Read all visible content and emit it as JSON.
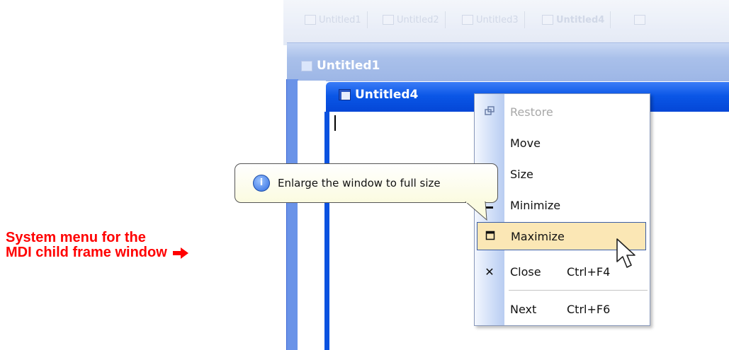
{
  "tabs": [
    {
      "label": "Untitled1",
      "bold": false
    },
    {
      "label": "Untitled2",
      "bold": false
    },
    {
      "label": "Untitled3",
      "bold": false
    },
    {
      "label": "Untitled4",
      "bold": true
    },
    {
      "label": "",
      "bold": false
    }
  ],
  "background_window": {
    "title": "Untitled1"
  },
  "active_window": {
    "title": "Untitled4"
  },
  "system_menu": {
    "items": [
      {
        "label": "Restore",
        "shortcut": "",
        "icon": "restore-icon",
        "disabled": true,
        "highlighted": false
      },
      {
        "label": "Move",
        "shortcut": "",
        "icon": "",
        "disabled": false,
        "highlighted": false
      },
      {
        "label": "Size",
        "shortcut": "",
        "icon": "",
        "disabled": false,
        "highlighted": false
      },
      {
        "label": "Minimize",
        "shortcut": "",
        "icon": "minimize-icon",
        "disabled": false,
        "highlighted": false
      },
      {
        "label": "Maximize",
        "shortcut": "",
        "icon": "maximize-icon",
        "disabled": false,
        "highlighted": true
      },
      {
        "label": "Close",
        "shortcut": "Ctrl+F4",
        "icon": "close-icon",
        "disabled": false,
        "highlighted": false
      },
      {
        "label": "Next",
        "shortcut": "Ctrl+F6",
        "icon": "",
        "disabled": false,
        "highlighted": false
      }
    ]
  },
  "tooltip": {
    "text": "Enlarge the window to full size",
    "icon": "info-icon"
  },
  "annotation": {
    "line1": "System menu for the",
    "line2": "MDI child frame window",
    "arrow": "red-arrow-icon"
  },
  "colors": {
    "annotation": "#ff0000",
    "title_bar_active": "#0a56e6",
    "menu_highlight": "#fbe7b5"
  }
}
